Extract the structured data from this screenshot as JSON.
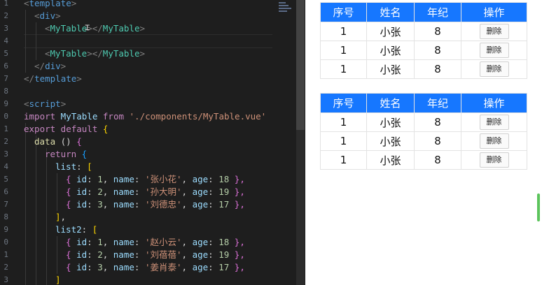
{
  "editor": {
    "line_numbers": [
      "1",
      "2",
      "3",
      "4",
      "5",
      "6",
      "7",
      "8",
      "9",
      "0",
      "1",
      "2",
      "3",
      "4",
      "5",
      "6",
      "7",
      "8",
      "9",
      "0",
      "1",
      "2",
      "3"
    ],
    "code": {
      "l1": {
        "a": "<",
        "b": "template",
        "c": ">"
      },
      "l2": {
        "a": "<",
        "b": "div",
        "c": ">"
      },
      "l3": {
        "a": "<",
        "b": "MyTable",
        "c": "></",
        "d": "MyTable",
        "e": ">"
      },
      "l5": {
        "a": "<",
        "b": "MyTable",
        "c": "></",
        "d": "MyTable",
        "e": ">"
      },
      "l6": {
        "a": "</",
        "b": "div",
        "c": ">"
      },
      "l7": {
        "a": "</",
        "b": "template",
        "c": ">"
      },
      "l9": {
        "a": "<",
        "b": "script",
        "c": ">"
      },
      "l10": {
        "kw": "import",
        "id": " MyTable ",
        "from": "from",
        "str": " './components/MyTable.vue'"
      },
      "l11": {
        "kw": "export default",
        "brace": " {"
      },
      "l12": {
        "fn": "data",
        "p": " () ",
        "brace": "{"
      },
      "l13": {
        "kw": "return",
        "brace": " {"
      },
      "l14": {
        "id": "list",
        "p": ": ",
        "brace": "["
      },
      "l15": {
        "a": "{ ",
        "k1": "id",
        "p1": ": ",
        "n1": "1",
        "p2": ", ",
        "k2": "name",
        "p3": ": ",
        "s": "'张小花'",
        "p4": ", ",
        "k3": "age",
        "p5": ": ",
        "n2": "18",
        "z": " },"
      },
      "l16": {
        "a": "{ ",
        "k1": "id",
        "p1": ": ",
        "n1": "2",
        "p2": ", ",
        "k2": "name",
        "p3": ": ",
        "s": "'孙大明'",
        "p4": ", ",
        "k3": "age",
        "p5": ": ",
        "n2": "19",
        "z": " },"
      },
      "l17": {
        "a": "{ ",
        "k1": "id",
        "p1": ": ",
        "n1": "3",
        "p2": ", ",
        "k2": "name",
        "p3": ": ",
        "s": "'刘德忠'",
        "p4": ", ",
        "k3": "age",
        "p5": ": ",
        "n2": "17",
        "z": " },"
      },
      "l18": {
        "brace": "]",
        "p": ","
      },
      "l19": {
        "id": "list2",
        "p": ": ",
        "brace": "["
      },
      "l20": {
        "a": "{ ",
        "k1": "id",
        "p1": ": ",
        "n1": "1",
        "p2": ", ",
        "k2": "name",
        "p3": ": ",
        "s": "'赵小云'",
        "p4": ", ",
        "k3": "age",
        "p5": ": ",
        "n2": "18",
        "z": " },"
      },
      "l21": {
        "a": "{ ",
        "k1": "id",
        "p1": ": ",
        "n1": "2",
        "p2": ", ",
        "k2": "name",
        "p3": ": ",
        "s": "'刘蓓蓓'",
        "p4": ", ",
        "k3": "age",
        "p5": ": ",
        "n2": "19",
        "z": " },"
      },
      "l22": {
        "a": "{ ",
        "k1": "id",
        "p1": ": ",
        "n1": "3",
        "p2": ", ",
        "k2": "name",
        "p3": ": ",
        "s": "'姜肖泰'",
        "p4": ", ",
        "k3": "age",
        "p5": ": ",
        "n2": "17",
        "z": " },"
      },
      "l23": {
        "brace": "]"
      }
    }
  },
  "tables": [
    {
      "headers": [
        "序号",
        "姓名",
        "年纪",
        "操作"
      ],
      "rows": [
        {
          "id": "1",
          "name": "小张",
          "age": "8",
          "action": "删除"
        },
        {
          "id": "1",
          "name": "小张",
          "age": "8",
          "action": "删除"
        },
        {
          "id": "1",
          "name": "小张",
          "age": "8",
          "action": "删除"
        }
      ]
    },
    {
      "headers": [
        "序号",
        "姓名",
        "年纪",
        "操作"
      ],
      "rows": [
        {
          "id": "1",
          "name": "小张",
          "age": "8",
          "action": "删除"
        },
        {
          "id": "1",
          "name": "小张",
          "age": "8",
          "action": "删除"
        },
        {
          "id": "1",
          "name": "小张",
          "age": "8",
          "action": "删除"
        }
      ]
    }
  ],
  "colors": {
    "header_bg": "#1677ff",
    "editor_bg": "#1e1e1e"
  }
}
